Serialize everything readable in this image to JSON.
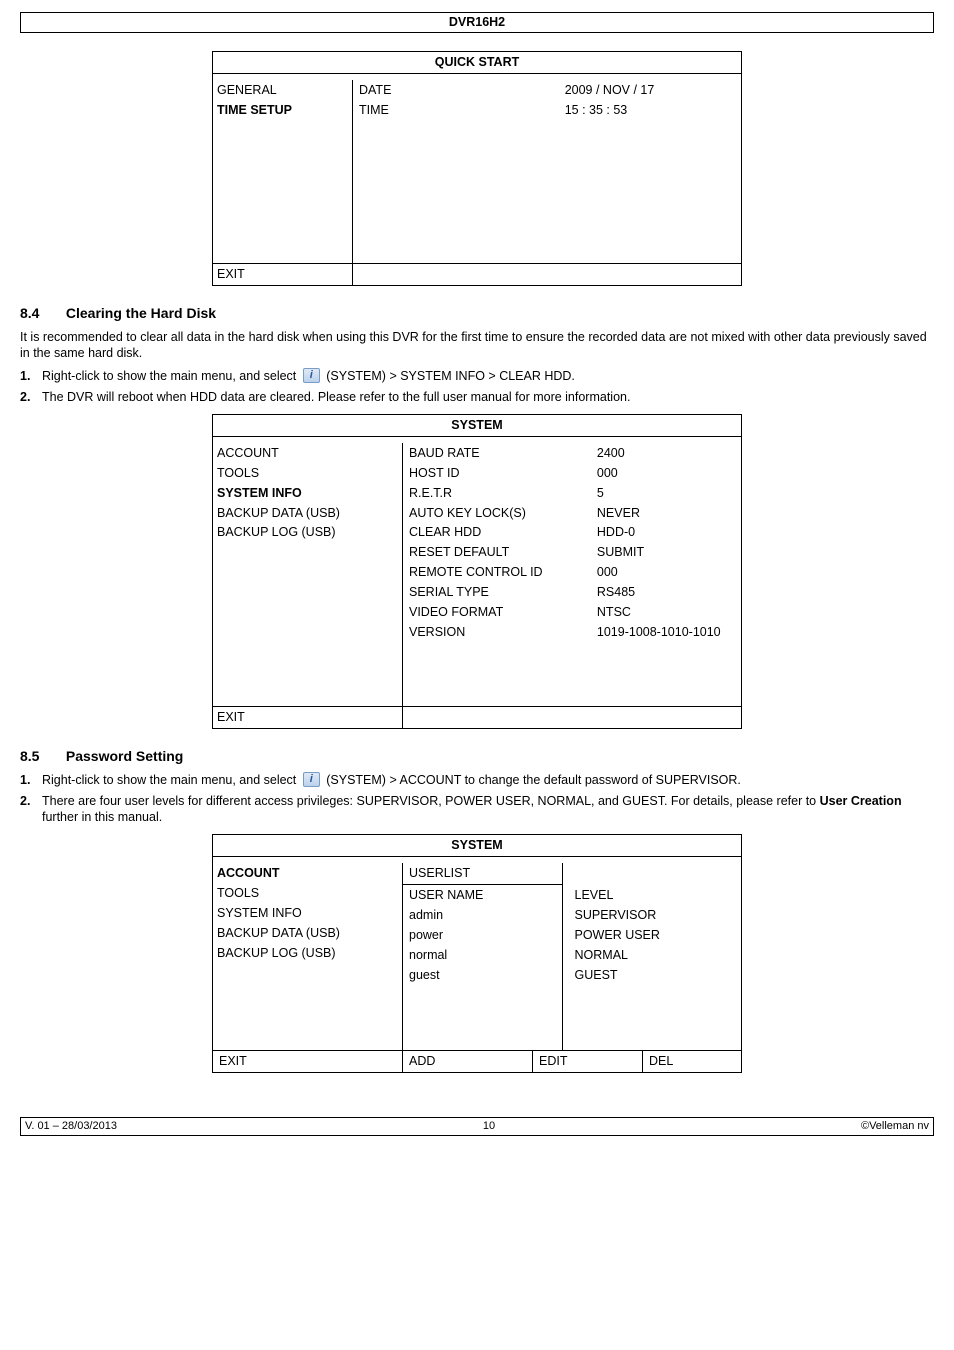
{
  "doc_title": "DVR16H2",
  "panel1": {
    "title": "QUICK START",
    "left": [
      "GENERAL",
      "TIME SETUP"
    ],
    "mid": [
      "DATE",
      "TIME"
    ],
    "right": [
      "2009 / NOV / 17",
      "15 : 35 : 53"
    ],
    "exit": "EXIT"
  },
  "sec84": {
    "num": "8.4",
    "title": "Clearing the Hard Disk",
    "para": "It is recommended to clear all data in the hard disk when using this DVR for the first time to ensure the recorded data are not mixed with other data previously saved in the same hard disk.",
    "step1a": "Right-click to show the main menu, and select ",
    "step1b": " (SYSTEM) > SYSTEM INFO > CLEAR HDD.",
    "step2": "The DVR will reboot when HDD data are cleared. Please refer to the full user manual for more information."
  },
  "panel2": {
    "title": "SYSTEM",
    "left": [
      "ACCOUNT",
      "TOOLS",
      "SYSTEM INFO",
      "BACKUP DATA (USB)",
      "BACKUP LOG (USB)"
    ],
    "mid": [
      "BAUD RATE",
      "HOST ID",
      "R.E.T.R",
      "AUTO KEY LOCK(S)",
      "CLEAR HDD",
      "RESET DEFAULT",
      "REMOTE CONTROL ID",
      "SERIAL TYPE",
      "VIDEO FORMAT",
      "VERSION"
    ],
    "right": [
      "2400",
      "000",
      "5",
      "NEVER",
      "HDD-0",
      "SUBMIT",
      "000",
      "RS485",
      "NTSC",
      "1019-1008-1010-1010"
    ],
    "exit": "EXIT"
  },
  "sec85": {
    "num": "8.5",
    "title": "Password Setting",
    "step1a": "Right-click to show the main menu, and select ",
    "step1b": " (SYSTEM) > ACCOUNT to change the default password of SUPERVISOR.",
    "step2a": "There are four user levels for different access privileges: SUPERVISOR, POWER USER, NORMAL, and GUEST. For details, please refer to ",
    "step2bold": "User Creation",
    "step2b": " further in this manual."
  },
  "panel3": {
    "title": "SYSTEM",
    "left": [
      "ACCOUNT",
      "TOOLS",
      "SYSTEM INFO",
      "BACKUP DATA (USB)",
      "BACKUP LOG (USB)"
    ],
    "mid_head": "USERLIST",
    "mid": [
      "USER NAME",
      "admin",
      "power",
      "normal",
      "guest"
    ],
    "right": [
      "LEVEL",
      "SUPERVISOR",
      "POWER USER",
      "NORMAL",
      "GUEST"
    ],
    "exit": "EXIT",
    "add": "ADD",
    "edit": "EDIT",
    "del": "DEL"
  },
  "footer": {
    "left": "V. 01 – 28/03/2013",
    "mid": "10",
    "right": "©Velleman nv"
  }
}
